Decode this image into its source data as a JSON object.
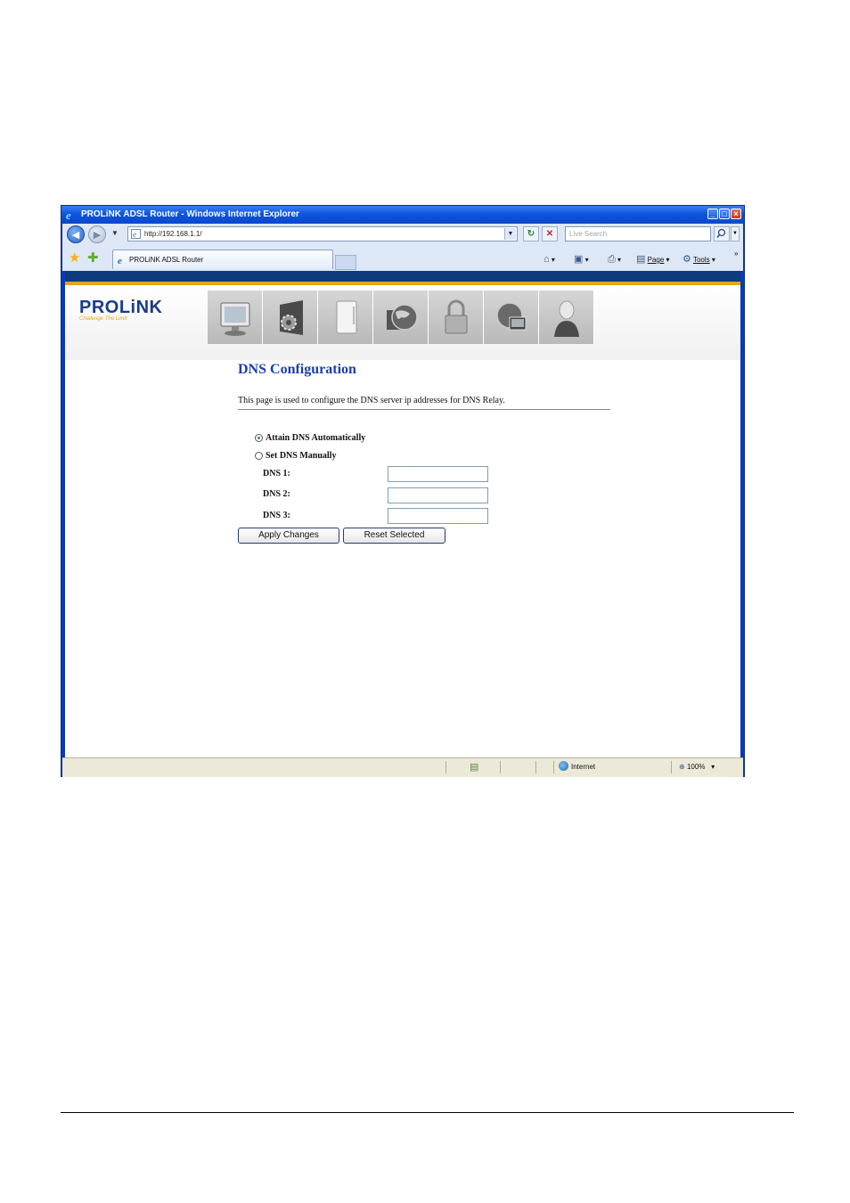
{
  "window": {
    "title": "PROLiNK ADSL Router - Windows Internet Explorer",
    "controls": [
      "minimize",
      "maximize",
      "close"
    ]
  },
  "toolbar": {
    "address": "http://192.168.1.1/",
    "search_placeholder": "Live Search"
  },
  "tabs": [
    {
      "label": "PROLiNK ADSL Router",
      "active": true
    }
  ],
  "command_bar": {
    "page_label": "Page",
    "tools_label": "Tools",
    "more": "»"
  },
  "branding": {
    "logo": "PROLiNK",
    "tagline": "Challenge The Limit",
    "colors": {
      "navy": "#0c3c7d",
      "gold": "#e3a51c",
      "title_blue": "#1a3fb0"
    }
  },
  "nav_icons": [
    "monitor-icon",
    "gear-folder-icon",
    "device-icon",
    "globe-folder-icon",
    "lock-icon",
    "network-globe-icon",
    "user-icon"
  ],
  "dns": {
    "title": "DNS Configuration",
    "description": "This page is used to configure the DNS server ip addresses for DNS Relay.",
    "option_auto": "Attain DNS Automatically",
    "option_manual": "Set DNS Manually",
    "selected": "auto",
    "fields": [
      {
        "label": "DNS 1:",
        "value": ""
      },
      {
        "label": "DNS 2:",
        "value": ""
      },
      {
        "label": "DNS 3:",
        "value": ""
      }
    ],
    "apply_label": "Apply Changes",
    "reset_label": "Reset Selected"
  },
  "status": {
    "zone": "Internet",
    "zoom": "100%"
  }
}
